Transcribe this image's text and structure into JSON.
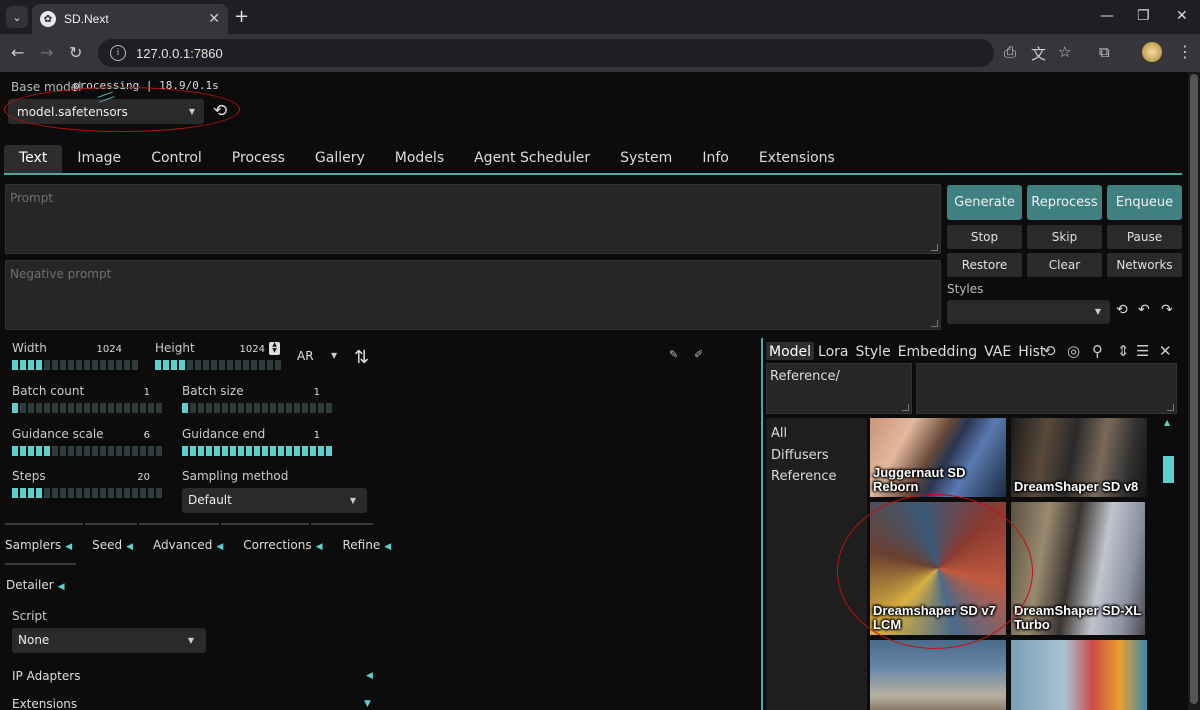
{
  "browser": {
    "tab_title": "SD.Next",
    "url": "127.0.0.1:7860",
    "new_tab": "+",
    "minimize": "—",
    "restore": "❐",
    "close": "✕"
  },
  "header": {
    "base_model_label": "Base model",
    "status": "processing | 18.9/0.1s",
    "model_value": "model.safetensors"
  },
  "main_tabs": [
    "Text",
    "Image",
    "Control",
    "Process",
    "Gallery",
    "Models",
    "Agent Scheduler",
    "System",
    "Info",
    "Extensions"
  ],
  "prompt": {
    "placeholder": "Prompt"
  },
  "negative_prompt": {
    "placeholder": "Negative prompt"
  },
  "buttons": {
    "generate": "Generate",
    "reprocess": "Reprocess",
    "enqueue": "Enqueue",
    "stop": "Stop",
    "skip": "Skip",
    "pause": "Pause",
    "restore": "Restore",
    "clear": "Clear",
    "networks": "Networks"
  },
  "styles": {
    "label": "Styles",
    "value": ""
  },
  "params": {
    "width": {
      "label": "Width",
      "value": "1024",
      "fraction": 0.25
    },
    "height": {
      "label": "Height",
      "value": "1024",
      "fraction": 0.25
    },
    "ar": "AR",
    "batch_count": {
      "label": "Batch count",
      "value": "1",
      "fraction": 0.05
    },
    "batch_size": {
      "label": "Batch size",
      "value": "1",
      "fraction": 0.05
    },
    "guidance_scale": {
      "label": "Guidance scale",
      "value": "6",
      "fraction": 0.25
    },
    "guidance_end": {
      "label": "Guidance end",
      "value": "1",
      "fraction": 1.0
    },
    "steps": {
      "label": "Steps",
      "value": "20",
      "fraction": 0.2
    },
    "sampling_method": {
      "label": "Sampling method",
      "value": "Default"
    }
  },
  "accordions": [
    "Samplers",
    "Seed",
    "Advanced",
    "Corrections",
    "Refine"
  ],
  "detailer": "Detailer",
  "script": {
    "label": "Script",
    "value": "None"
  },
  "ip_adapters": "IP Adapters",
  "extensions": "Extensions",
  "networks": {
    "tabs": [
      "Model",
      "Lora",
      "Style",
      "Embedding",
      "VAE",
      "Hist"
    ],
    "path": "Reference/",
    "categories": [
      "All",
      "Diffusers",
      "Reference"
    ],
    "cards": [
      "Juggernaut SD Reborn",
      "DreamShaper SD v8",
      "Dreamshaper SD v7 LCM",
      "DreamShaper SD-XL Turbo"
    ]
  },
  "colors": {
    "accent": "#4aa8a8",
    "slider_on": "#5ccfcf",
    "primary_button": "#3f8080",
    "annotation_red": "#c01010"
  }
}
